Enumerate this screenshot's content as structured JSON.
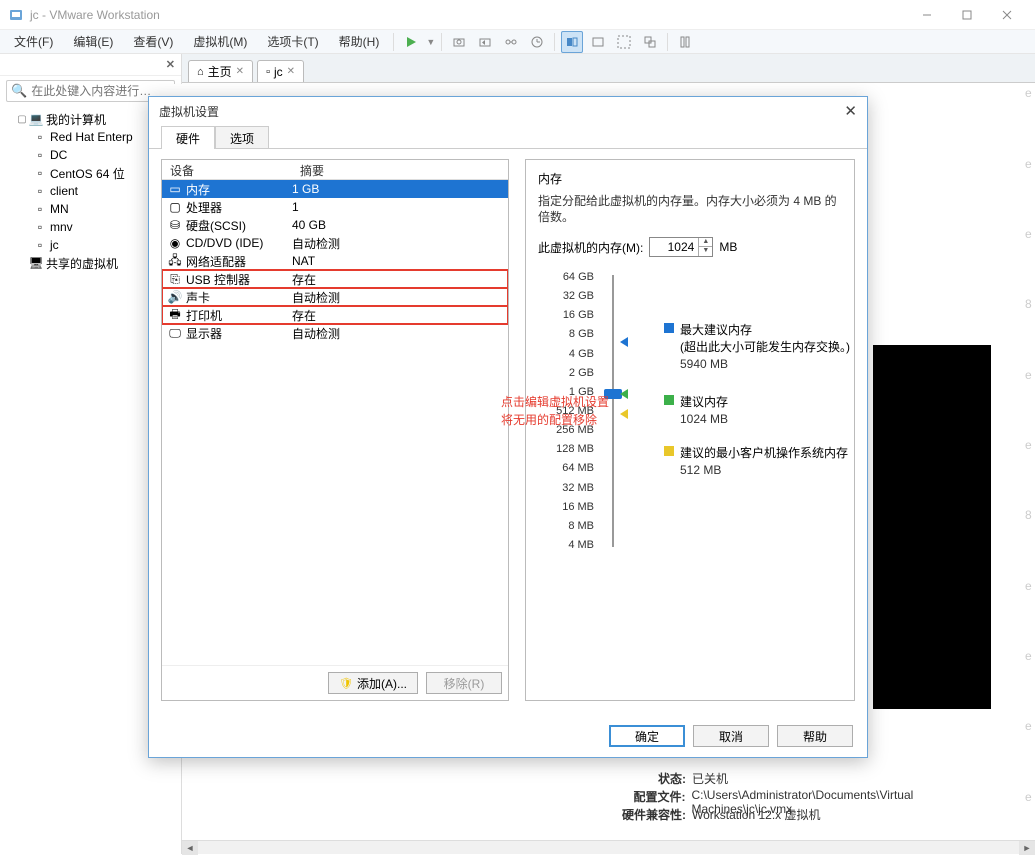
{
  "window": {
    "title": "jc - VMware Workstation"
  },
  "menu": [
    "文件(F)",
    "编辑(E)",
    "查看(V)",
    "虚拟机(M)",
    "选项卡(T)",
    "帮助(H)"
  ],
  "sidebar": {
    "search_placeholder": "在此处键入内容进行…",
    "root": "我的计算机",
    "items": [
      "Red Hat Enterp",
      "DC",
      "CentOS 64 位",
      "client",
      "MN",
      "mnv",
      "jc"
    ],
    "shared": "共享的虚拟机"
  },
  "tabs": [
    {
      "icon": "home",
      "label": "主页"
    },
    {
      "icon": "vm",
      "label": "jc"
    }
  ],
  "dialog": {
    "title": "虚拟机设置",
    "tabs": [
      "硬件",
      "选项"
    ],
    "headers": {
      "device": "设备",
      "summary": "摘要"
    },
    "devices": [
      {
        "icon": "mem",
        "name": "内存",
        "summary": "1 GB",
        "sel": true
      },
      {
        "icon": "cpu",
        "name": "处理器",
        "summary": "1"
      },
      {
        "icon": "hdd",
        "name": "硬盘(SCSI)",
        "summary": "40 GB"
      },
      {
        "icon": "cd",
        "name": "CD/DVD (IDE)",
        "summary": "自动检测"
      },
      {
        "icon": "net",
        "name": "网络适配器",
        "summary": "NAT"
      },
      {
        "icon": "usb",
        "name": "USB 控制器",
        "summary": "存在",
        "red": true
      },
      {
        "icon": "snd",
        "name": "声卡",
        "summary": "自动检测",
        "red": true
      },
      {
        "icon": "prn",
        "name": "打印机",
        "summary": "存在",
        "red": true
      },
      {
        "icon": "disp",
        "name": "显示器",
        "summary": "自动检测"
      }
    ],
    "red_note_1": "点击编辑虚拟机设置",
    "red_note_2": "将无用的配置移除",
    "add": "添加(A)...",
    "remove": "移除(R)",
    "ok": "确定",
    "cancel": "取消",
    "help": "帮助",
    "mem": {
      "heading": "内存",
      "desc": "指定分配给此虚拟机的内存量。内存大小必须为 4 MB 的倍数。",
      "label": "此虚拟机的内存(M):",
      "value": "1024",
      "unit": "MB",
      "scale": [
        "64 GB",
        "32 GB",
        "16 GB",
        "8 GB",
        "4 GB",
        "2 GB",
        "1 GB",
        "512 MB",
        "256 MB",
        "128 MB",
        "64 MB",
        "32 MB",
        "16 MB",
        "8 MB",
        "4 MB"
      ],
      "legend_max": "最大建议内存",
      "legend_max_note": "(超出此大小可能发生内存交换。)",
      "legend_max_val": "5940 MB",
      "legend_rec": "建议内存",
      "legend_rec_val": "1024 MB",
      "legend_min": "建议的最小客户机操作系统内存",
      "legend_min_val": "512 MB"
    }
  },
  "status": {
    "state_l": "状态:",
    "state_v": "已关机",
    "cfg_l": "配置文件:",
    "cfg_v": "C:\\Users\\Administrator\\Documents\\Virtual Machines\\jc\\jc.vmx",
    "compat_l": "硬件兼容性:",
    "compat_v": "Workstation 12.x 虚拟机"
  }
}
